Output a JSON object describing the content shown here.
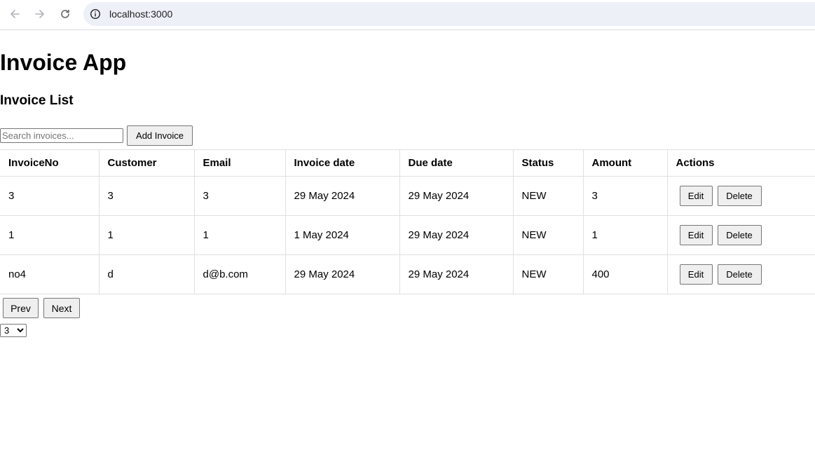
{
  "browser": {
    "url": "localhost:3000"
  },
  "app": {
    "title": "Invoice App",
    "list_title": "Invoice List"
  },
  "toolbar": {
    "search_placeholder": "Search invoices...",
    "search_value": "",
    "add_label": "Add Invoice"
  },
  "table": {
    "columns": [
      "InvoiceNo",
      "Customer",
      "Email",
      "Invoice date",
      "Due date",
      "Status",
      "Amount",
      "Actions"
    ],
    "rows": [
      [
        "3",
        "3",
        "3",
        "29 May 2024",
        "29 May 2024",
        "NEW",
        "3"
      ],
      [
        "1",
        "1",
        "1",
        "1 May 2024",
        "29 May 2024",
        "NEW",
        "1"
      ],
      [
        "no4",
        "d",
        "d@b.com",
        "29 May 2024",
        "29 May 2024",
        "NEW",
        "400"
      ]
    ],
    "edit_label": "Edit",
    "delete_label": "Delete"
  },
  "pagination": {
    "prev_label": "Prev",
    "next_label": "Next",
    "page_size": "3"
  }
}
